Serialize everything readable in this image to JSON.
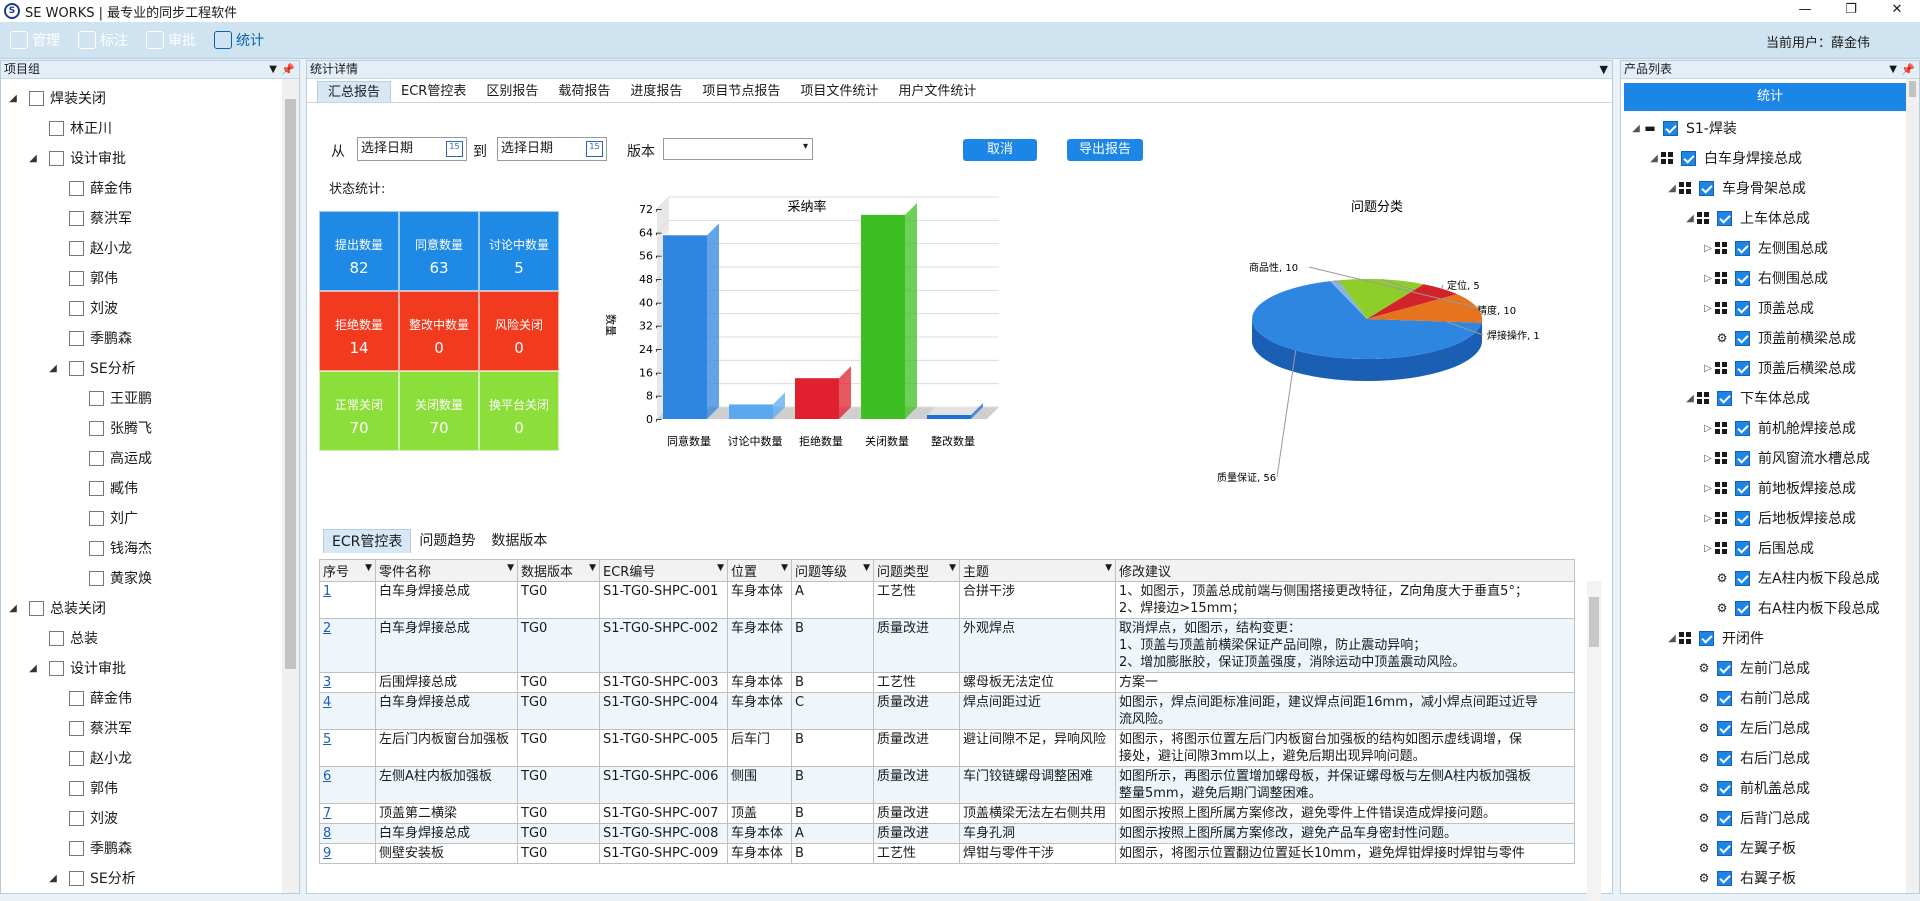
{
  "window": {
    "title": "SE WORKS | 最专业的同步工程软件",
    "logo": "S"
  },
  "toolbar": {
    "items": [
      {
        "label": "管理",
        "icon": "person-icon"
      },
      {
        "label": "标注",
        "icon": "edit-icon"
      },
      {
        "label": "审批",
        "icon": "approve-icon"
      },
      {
        "label": "统计",
        "icon": "chart-icon"
      }
    ],
    "current_user": "当前用户：薛金伟"
  },
  "left_panel": {
    "title": "项目组",
    "rows": [
      {
        "label": "焊装关闭",
        "arrow": "◢",
        "indent": 0
      },
      {
        "label": "林正川",
        "arrow": "",
        "indent": 1
      },
      {
        "label": "设计审批",
        "arrow": "◢",
        "indent": 1
      },
      {
        "label": "薛金伟",
        "arrow": "",
        "indent": 2
      },
      {
        "label": "蔡洪军",
        "arrow": "",
        "indent": 2
      },
      {
        "label": "赵小龙",
        "arrow": "",
        "indent": 2
      },
      {
        "label": "郭伟",
        "arrow": "",
        "indent": 2
      },
      {
        "label": "刘波",
        "arrow": "",
        "indent": 2
      },
      {
        "label": "季鹏森",
        "arrow": "",
        "indent": 2
      },
      {
        "label": "SE分析",
        "arrow": "◢",
        "indent": 2
      },
      {
        "label": "王亚鹏",
        "arrow": "",
        "indent": 3
      },
      {
        "label": "张腾飞",
        "arrow": "",
        "indent": 3
      },
      {
        "label": "高运成",
        "arrow": "",
        "indent": 3
      },
      {
        "label": "臧伟",
        "arrow": "",
        "indent": 3
      },
      {
        "label": "刘广",
        "arrow": "",
        "indent": 3
      },
      {
        "label": "钱海杰",
        "arrow": "",
        "indent": 3
      },
      {
        "label": "黄家焕",
        "arrow": "",
        "indent": 3
      },
      {
        "label": "总装关闭",
        "arrow": "◢",
        "indent": 0
      },
      {
        "label": "总装",
        "arrow": "",
        "indent": 1
      },
      {
        "label": "设计审批",
        "arrow": "◢",
        "indent": 1
      },
      {
        "label": "薛金伟",
        "arrow": "",
        "indent": 2
      },
      {
        "label": "蔡洪军",
        "arrow": "",
        "indent": 2
      },
      {
        "label": "赵小龙",
        "arrow": "",
        "indent": 2
      },
      {
        "label": "郭伟",
        "arrow": "",
        "indent": 2
      },
      {
        "label": "刘波",
        "arrow": "",
        "indent": 2
      },
      {
        "label": "季鹏森",
        "arrow": "",
        "indent": 2
      },
      {
        "label": "SE分析",
        "arrow": "◢",
        "indent": 2
      }
    ]
  },
  "center": {
    "title": "统计详情",
    "tabs": [
      "汇总报告",
      "ECR管控表",
      "区别报告",
      "载荷报告",
      "进度报告",
      "项目节点报告",
      "项目文件统计",
      "用户文件统计"
    ],
    "filter": {
      "from": "从",
      "to": "到",
      "date_placeholder": "选择日期",
      "version_label": "版本",
      "cancel": "取消",
      "export": "导出报告",
      "cal_text": "15"
    },
    "stats_label": "状态统计:",
    "stats": [
      {
        "label": "提出数量",
        "value": "82",
        "color": "#1e8ae6"
      },
      {
        "label": "同意数量",
        "value": "63",
        "color": "#1e8ae6"
      },
      {
        "label": "讨论中数量",
        "value": "5",
        "color": "#1e8ae6"
      },
      {
        "label": "拒绝数量",
        "value": "14",
        "color": "#f23a1e"
      },
      {
        "label": "整改中数量",
        "value": "0",
        "color": "#f23a1e"
      },
      {
        "label": "风险关闭",
        "value": "0",
        "color": "#f23a1e"
      },
      {
        "label": "正常关闭",
        "value": "70",
        "color": "#8cde3a"
      },
      {
        "label": "关闭数量",
        "value": "70",
        "color": "#8cde3a"
      },
      {
        "label": "换平台关闭",
        "value": "0",
        "color": "#8cde3a"
      }
    ],
    "bottom_tabs": [
      "ECR管控表",
      "问题趋势",
      "数据版本"
    ],
    "table": {
      "columns": [
        "序号",
        "零件名称",
        "数据版本",
        "ECR编号",
        "位置",
        "问题等级",
        "问题类型",
        "主题",
        "修改建议"
      ],
      "rows": [
        [
          "1",
          "白车身焊接总成",
          "TG0",
          "S1-TG0-SHPC-001",
          "车身本体",
          "A",
          "工艺性",
          "合拼干涉",
          "1、如图示，顶盖总成前端与侧围搭接更改特征，Z向角度大于垂直5°；\n2、焊接边>15mm；"
        ],
        [
          "2",
          "白车身焊接总成",
          "TG0",
          "S1-TG0-SHPC-002",
          "车身本体",
          "B",
          "质量改进",
          "外观焊点",
          "取消焊点，如图示，结构变更：\n1、顶盖与顶盖前横梁保证产品间隙，防止震动异响；\n2、增加膨胀胶，保证顶盖强度，消除运动中顶盖震动风险。"
        ],
        [
          "3",
          "后围焊接总成",
          "TG0",
          "S1-TG0-SHPC-003",
          "车身本体",
          "B",
          "工艺性",
          "螺母板无法定位",
          "方案一"
        ],
        [
          "4",
          "白车身焊接总成",
          "TG0",
          "S1-TG0-SHPC-004",
          "车身本体",
          "C",
          "质量改进",
          "焊点间距过近",
          "如图示，焊点间距标准间距，建议焊点间距16mm，减小焊点间距过近导\n流风险。"
        ],
        [
          "5",
          "左后门内板窗台加强板",
          "TG0",
          "S1-TG0-SHPC-005",
          "后车门",
          "B",
          "质量改进",
          "避让间隙不足，异响风险",
          "如图示，将图示位置左后门内板窗台加强板的结构如图示虚线调增，保\n接处，避让间隙3mm以上，避免后期出现异响问题。"
        ],
        [
          "6",
          "左侧A柱内板加强板",
          "TG0",
          "S1-TG0-SHPC-006",
          "侧围",
          "B",
          "质量改进",
          "车门铰链螺母调整困难",
          "如图所示，再图示位置增加螺母板，并保证螺母板与左侧A柱内板加强板\n整量5mm，避免后期门调整困难。"
        ],
        [
          "7",
          "顶盖第二横梁",
          "TG0",
          "S1-TG0-SHPC-007",
          "顶盖",
          "B",
          "质量改进",
          "顶盖横梁无法左右侧共用",
          "如图示按照上图所属方案修改，避免零件上件错误造成焊接问题。"
        ],
        [
          "8",
          "白车身焊接总成",
          "TG0",
          "S1-TG0-SHPC-008",
          "车身本体",
          "A",
          "质量改进",
          "车身孔洞",
          "如图示按照上图所属方案修改，避免产品车身密封性问题。"
        ],
        [
          "9",
          "侧壁安装板",
          "TG0",
          "S1-TG0-SHPC-009",
          "车身本体",
          "B",
          "工艺性",
          "焊钳与零件干涉",
          "如图示，将图示位置翻边位置延长10mm，避免焊钳焊接时焊钳与零件"
        ]
      ]
    }
  },
  "right_panel": {
    "title": "产品列表",
    "button": "统计",
    "rows": [
      {
        "label": "S1-焊装",
        "indent": 0,
        "kind": "folder",
        "arrow": "◢"
      },
      {
        "label": "白车身焊接总成",
        "indent": 1,
        "kind": "group",
        "arrow": "◢"
      },
      {
        "label": "车身骨架总成",
        "indent": 2,
        "kind": "group",
        "arrow": "◢"
      },
      {
        "label": "上车体总成",
        "indent": 3,
        "kind": "group",
        "arrow": "◢"
      },
      {
        "label": "左侧围总成",
        "indent": 4,
        "kind": "group",
        "arrow": "▷"
      },
      {
        "label": "右侧围总成",
        "indent": 4,
        "kind": "group",
        "arrow": "▷"
      },
      {
        "label": "顶盖总成",
        "indent": 4,
        "kind": "group",
        "arrow": "▷"
      },
      {
        "label": "顶盖前横梁总成",
        "indent": 4,
        "kind": "gear",
        "arrow": ""
      },
      {
        "label": "顶盖后横梁总成",
        "indent": 4,
        "kind": "group",
        "arrow": "▷"
      },
      {
        "label": "下车体总成",
        "indent": 3,
        "kind": "group",
        "arrow": "◢"
      },
      {
        "label": "前机舱焊接总成",
        "indent": 4,
        "kind": "group",
        "arrow": "▷"
      },
      {
        "label": "前风窗流水槽总成",
        "indent": 4,
        "kind": "group",
        "arrow": "▷"
      },
      {
        "label": "前地板焊接总成",
        "indent": 4,
        "kind": "group",
        "arrow": "▷"
      },
      {
        "label": "后地板焊接总成",
        "indent": 4,
        "kind": "group",
        "arrow": "▷"
      },
      {
        "label": "后围总成",
        "indent": 4,
        "kind": "group",
        "arrow": "▷"
      },
      {
        "label": "左A柱内板下段总成",
        "indent": 4,
        "kind": "gear",
        "arrow": ""
      },
      {
        "label": "右A柱内板下段总成",
        "indent": 4,
        "kind": "gear",
        "arrow": ""
      },
      {
        "label": "开闭件",
        "indent": 2,
        "kind": "group",
        "arrow": "◢"
      },
      {
        "label": "左前门总成",
        "indent": 3,
        "kind": "gear",
        "arrow": ""
      },
      {
        "label": "右前门总成",
        "indent": 3,
        "kind": "gear",
        "arrow": ""
      },
      {
        "label": "左后门总成",
        "indent": 3,
        "kind": "gear",
        "arrow": ""
      },
      {
        "label": "右后门总成",
        "indent": 3,
        "kind": "gear",
        "arrow": ""
      },
      {
        "label": "前机盖总成",
        "indent": 3,
        "kind": "gear",
        "arrow": ""
      },
      {
        "label": "后背门总成",
        "indent": 3,
        "kind": "gear",
        "arrow": ""
      },
      {
        "label": "左翼子板",
        "indent": 3,
        "kind": "gear",
        "arrow": ""
      },
      {
        "label": "右翼子板",
        "indent": 3,
        "kind": "gear",
        "arrow": ""
      }
    ]
  },
  "chart_data": [
    {
      "type": "bar",
      "title": "采纳率",
      "ylabel": "数量",
      "categories": [
        "同意数量",
        "讨论中数量",
        "拒绝数量",
        "关闭数量",
        "整改数量"
      ],
      "values": [
        63,
        5,
        14,
        70,
        0
      ],
      "colors": [
        "#2f86e0",
        "#5aa8f0",
        "#e0202e",
        "#3dbf21",
        "#1e6fd8"
      ],
      "ylim": [
        0,
        72
      ],
      "yticks": [
        "0",
        "8",
        "16",
        "24",
        "32",
        "40",
        "48",
        "56",
        "64",
        "72"
      ],
      "grid": true
    },
    {
      "type": "pie",
      "title": "问题分类",
      "slices": [
        {
          "label": "质量保证",
          "value": 56,
          "color": "#2f86e0",
          "text": "质量保证, 56"
        },
        {
          "label": "焊接操作",
          "value": 1,
          "color": "#8ab4e0",
          "text": "焊接操作, 1"
        },
        {
          "label": "精度",
          "value": 10,
          "color": "#8fce2a",
          "text": "精度, 10"
        },
        {
          "label": "定位",
          "value": 5,
          "color": "#d2232a",
          "text": "定位, 5"
        },
        {
          "label": "商品性",
          "value": 10,
          "color": "#e6731e",
          "text": "商品性, 10"
        }
      ]
    }
  ]
}
